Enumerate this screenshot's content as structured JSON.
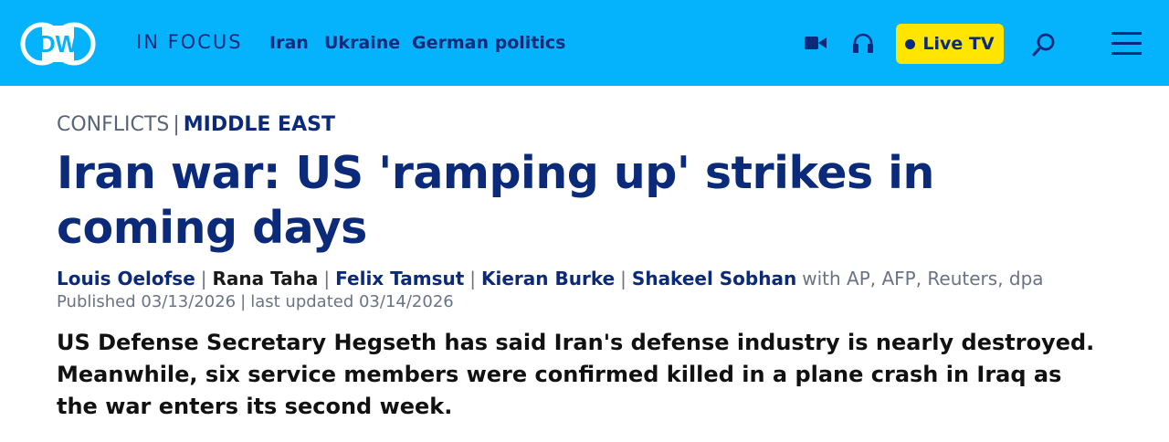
{
  "header": {
    "logo_text": "DW",
    "in_focus_label": "IN FOCUS",
    "nav_links": [
      "Iran",
      "Ukraine",
      "German politics"
    ],
    "icons": [
      "video-camera-icon",
      "headphones-icon",
      "search-icon",
      "hamburger-menu-icon"
    ],
    "live_label": "Live TV",
    "colors": {
      "bar": "#05b2fc",
      "nav_text": "#0b2a7a",
      "live_bg": "#ffe500"
    }
  },
  "article": {
    "category": "CONFLICTS",
    "subcategory": "MIDDLE EAST",
    "title": "Iran war: US 'ramping up' strikes in coming days",
    "authors": [
      "Louis Oelofse",
      "Rana Taha",
      "Felix Tamsut",
      "Kieran Burke",
      "Shakeel Sobhan"
    ],
    "agencies": "with AP, AFP, Reuters, dpa",
    "published": "Published 03/13/2026",
    "updated": "last updated 03/14/2026",
    "teaser": "US Defense Secretary Hegseth has said Iran's defense industry is nearly destroyed. Meanwhile, six service members were confirmed killed in a plane crash in Iraq as the war enters its second week."
  }
}
